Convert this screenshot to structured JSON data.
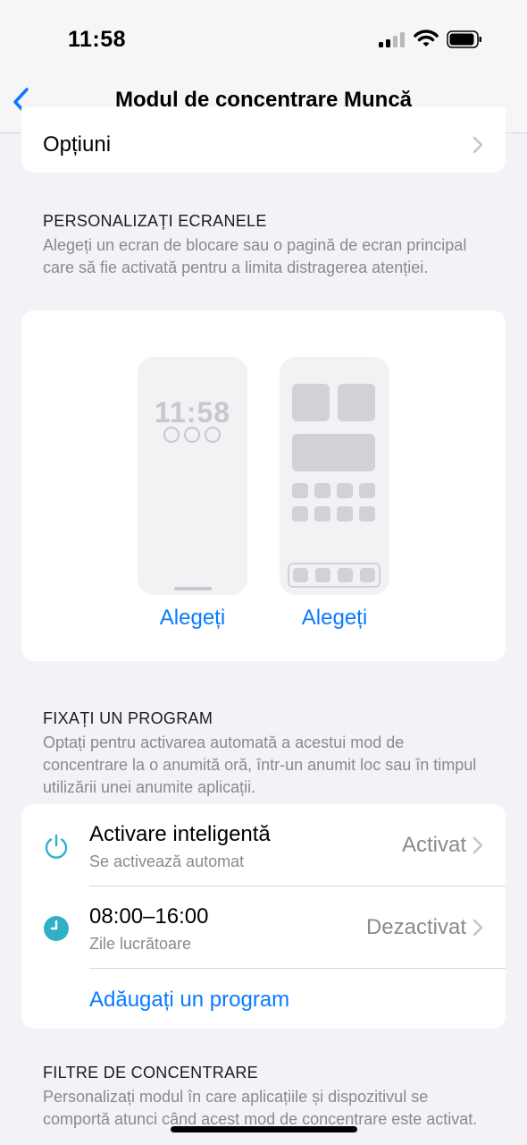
{
  "status": {
    "time": "11:58"
  },
  "nav": {
    "title": "Modul de concentrare Muncă"
  },
  "options": {
    "label": "Opțiuni"
  },
  "screens_section": {
    "header": "PERSONALIZAȚI ECRANELE",
    "footer": "Alegeți un ecran de blocare sau o pagină de ecran principal care să fie activată pentru a limita distragerea atenției.",
    "lock_preview_time": "11:58",
    "lock_choose": "Alegeți",
    "home_choose": "Alegeți"
  },
  "schedule_section": {
    "header": "FIXAȚI UN PROGRAM",
    "footer": "Optați pentru activarea automată a acestui mod de concentrare la o anumită oră, într-un anumit loc sau în timpul utilizării unei anumite aplicații.",
    "rows": [
      {
        "title": "Activare inteligentă",
        "subtitle": "Se activează automat",
        "value": "Activat",
        "icon": "power-icon"
      },
      {
        "title": "08:00–16:00",
        "subtitle": "Zile lucrătoare",
        "value": "Dezactivat",
        "icon": "clock-icon"
      }
    ],
    "add_label": "Adăugați un program"
  },
  "filters_section": {
    "header": "FILTRE DE CONCENTRARE",
    "footer": "Personalizați modul în care aplicațiile și dispozitivul se comportă atunci când acest mod de concentrare este activat."
  },
  "colors": {
    "accent": "#0a7aff",
    "teal": "#30b0c7",
    "secondary": "#8a8a8e"
  }
}
